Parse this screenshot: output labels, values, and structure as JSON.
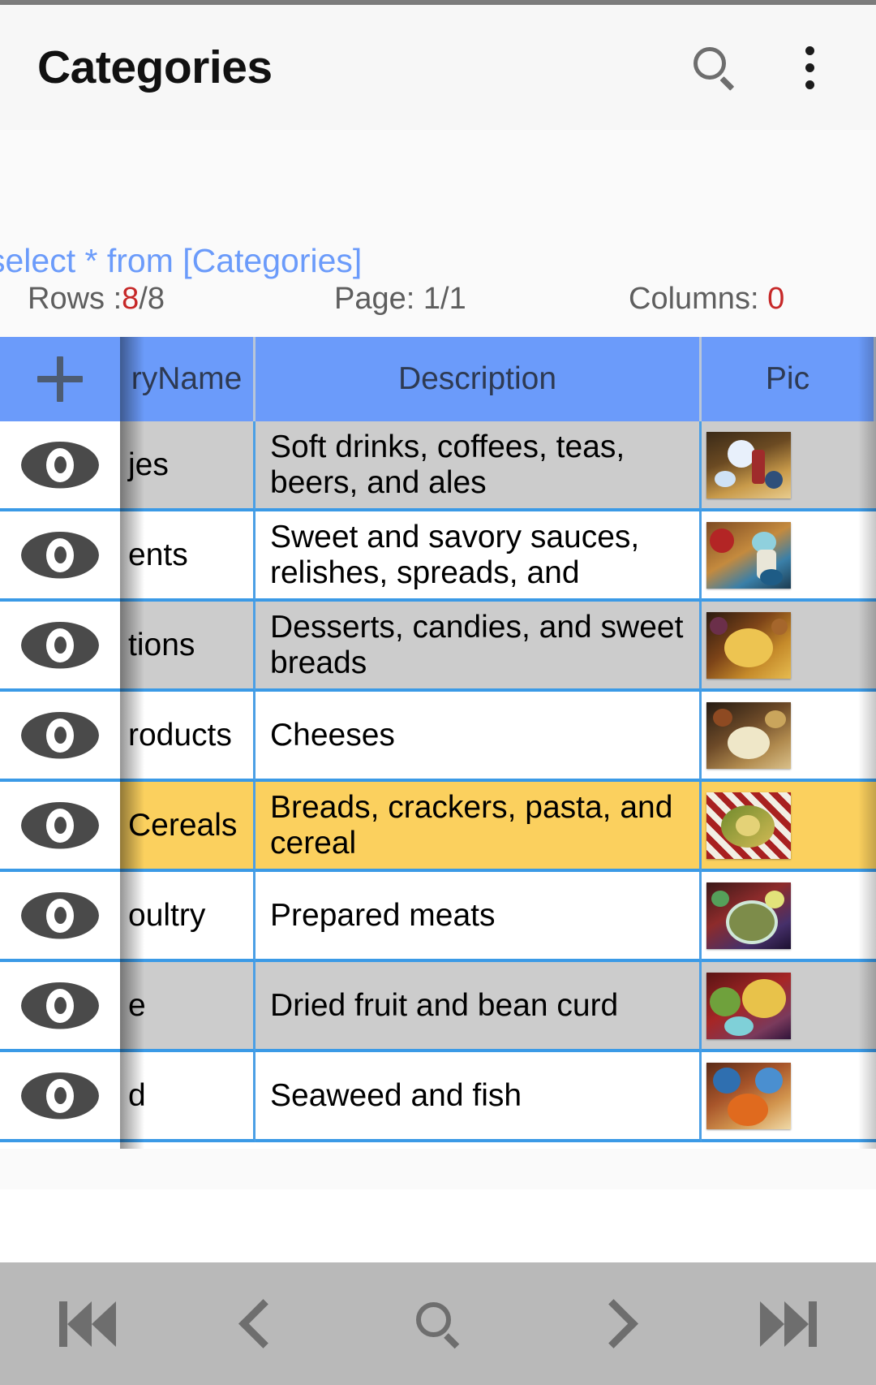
{
  "appbar": {
    "title": "Categories",
    "search_icon": "search-icon",
    "overflow_icon": "more-vertical-icon"
  },
  "query": {
    "sql": "select * from [Categories]",
    "rows_label": "Rows :",
    "rows_value": "8",
    "rows_total": "/8",
    "page_label": "Page: ",
    "page_value": "1/1",
    "columns_label": "Columns: ",
    "columns_value": "0"
  },
  "grid": {
    "add_icon": "plus-icon",
    "columns": [
      {
        "key": "actions",
        "label": ""
      },
      {
        "key": "name",
        "label": "ryName"
      },
      {
        "key": "description",
        "label": "Description"
      },
      {
        "key": "picture",
        "label": "Pic"
      }
    ],
    "rows": [
      {
        "view_icon": "eye-icon",
        "name": "jes",
        "description": "Soft drinks, coffees, teas, beers, and ales",
        "picture": "beverages-thumbnail",
        "shade": "gray"
      },
      {
        "view_icon": "eye-icon",
        "name": "ents",
        "description": "Sweet and savory sauces, relishes, spreads, and",
        "picture": "condiments-thumbnail",
        "shade": "white"
      },
      {
        "view_icon": "eye-icon",
        "name": "tions",
        "description": "Desserts, candies, and sweet breads",
        "picture": "confections-thumbnail",
        "shade": "gray"
      },
      {
        "view_icon": "eye-icon",
        "name": "roducts",
        "description": "Cheeses",
        "picture": "dairy-thumbnail",
        "shade": "white"
      },
      {
        "view_icon": "eye-icon",
        "name": "Cereals",
        "description": "Breads, crackers, pasta, and cereal",
        "picture": "grains-thumbnail",
        "shade": "yellow"
      },
      {
        "view_icon": "eye-icon",
        "name": "oultry",
        "description": "Prepared meats",
        "picture": "meat-thumbnail",
        "shade": "white"
      },
      {
        "view_icon": "eye-icon",
        "name": "e",
        "description": "Dried fruit and bean curd",
        "picture": "produce-thumbnail",
        "shade": "gray"
      },
      {
        "view_icon": "eye-icon",
        "name": "d",
        "description": "Seaweed and fish",
        "picture": "seafood-thumbnail",
        "shade": "white"
      }
    ]
  },
  "bottomnav": {
    "first_icon": "skip-to-first-icon",
    "prev_icon": "chevron-left-icon",
    "search_icon": "search-icon",
    "next_icon": "chevron-right-icon",
    "last_icon": "skip-to-last-icon"
  },
  "colors": {
    "header_blue": "#6b9bfa",
    "row_gray": "#cccccc",
    "row_highlight": "#fbd05e",
    "grid_line": "#4b9fe5",
    "sql_blue": "#6b9bfa",
    "accent_red": "#c62828",
    "bottom_bar": "#b9b9b9"
  }
}
